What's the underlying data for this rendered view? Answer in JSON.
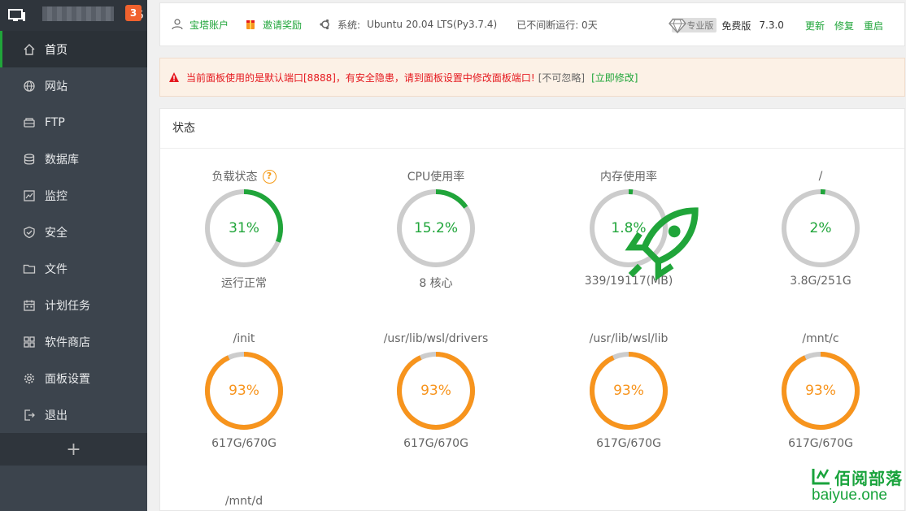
{
  "sidebar": {
    "server_name": "35",
    "notification_count": "3",
    "items": [
      {
        "label": "首页",
        "icon": "home-icon",
        "active": true
      },
      {
        "label": "网站",
        "icon": "globe-icon"
      },
      {
        "label": "FTP",
        "icon": "ftp-icon"
      },
      {
        "label": "数据库",
        "icon": "database-icon"
      },
      {
        "label": "监控",
        "icon": "monitor-chart-icon"
      },
      {
        "label": "安全",
        "icon": "shield-icon"
      },
      {
        "label": "文件",
        "icon": "folder-icon"
      },
      {
        "label": "计划任务",
        "icon": "calendar-icon"
      },
      {
        "label": "软件商店",
        "icon": "apps-grid-icon"
      },
      {
        "label": "面板设置",
        "icon": "gear-icon"
      },
      {
        "label": "退出",
        "icon": "logout-icon"
      }
    ],
    "add_label": "+"
  },
  "topbar": {
    "account": "宝塔账户",
    "invite": "邀请奖励",
    "system_label": "系统:",
    "system_value": "Ubuntu 20.04 LTS(Py3.7.4)",
    "uptime": "已不间断运行: 0天",
    "pro_tag": "专业版",
    "free_label": "免费版",
    "version": "7.3.0",
    "update": "更新",
    "repair": "修复",
    "restart": "重启"
  },
  "alert": {
    "message": "当前面板使用的是默认端口[8888]，有安全隐患，请到面板设置中修改面板端口!",
    "ignore": "[不可忽略]",
    "fix": "[立即修改]"
  },
  "status": {
    "title": "状态",
    "gauges": [
      {
        "label": "负载状态",
        "value": 31,
        "display": "31%",
        "sub": "运行正常",
        "help": "?",
        "level": "normal"
      },
      {
        "label": "CPU使用率",
        "value": 15.2,
        "display": "15.2%",
        "sub": "8 核心",
        "level": "normal"
      },
      {
        "label": "内存使用率",
        "value": 1.8,
        "display": "1.8%",
        "sub": "339/19117(MB)",
        "level": "normal",
        "icon": "rocket-icon"
      },
      {
        "label": "/",
        "value": 2,
        "display": "2%",
        "sub": "3.8G/251G",
        "level": "normal"
      },
      {
        "label": "/init",
        "value": 93,
        "display": "93%",
        "sub": "617G/670G",
        "level": "warning"
      },
      {
        "label": "/usr/lib/wsl/drivers",
        "value": 93,
        "display": "93%",
        "sub": "617G/670G",
        "level": "warning"
      },
      {
        "label": "/usr/lib/wsl/lib",
        "value": 93,
        "display": "93%",
        "sub": "617G/670G",
        "level": "warning"
      },
      {
        "label": "/mnt/c",
        "value": 93,
        "display": "93%",
        "sub": "617G/670G",
        "level": "warning"
      },
      {
        "label": "/mnt/d"
      }
    ]
  },
  "colors": {
    "normal": "#20a53a",
    "warning": "#f7941d",
    "track": "#cccccc",
    "sidebar_bg": "#3c444d",
    "alert_text": "#e5191f"
  },
  "watermark": {
    "title": "佰阅部落",
    "url": "baiyue.one"
  }
}
